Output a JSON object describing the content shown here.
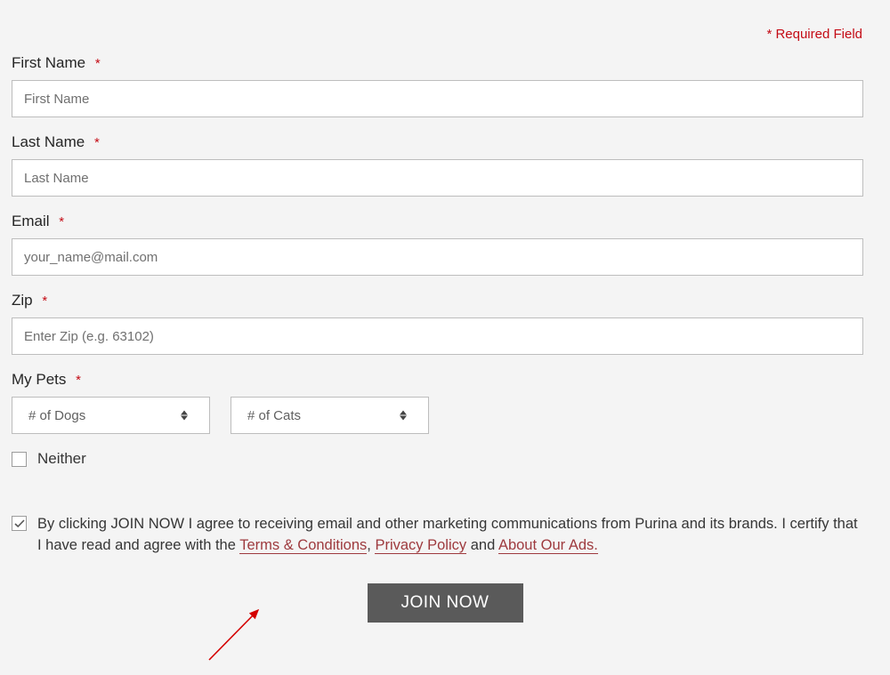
{
  "required_note": "* Required Field",
  "asterisk": "*",
  "fields": {
    "first_name": {
      "label": "First Name",
      "placeholder": "First Name"
    },
    "last_name": {
      "label": "Last Name",
      "placeholder": "Last Name"
    },
    "email": {
      "label": "Email",
      "placeholder": "your_name@mail.com"
    },
    "zip": {
      "label": "Zip",
      "placeholder": "Enter Zip (e.g. 63102)"
    }
  },
  "my_pets": {
    "label": "My Pets",
    "dogs_placeholder": "# of Dogs",
    "cats_placeholder": "# of Cats"
  },
  "neither": {
    "label": "Neither",
    "checked": false
  },
  "consent": {
    "checked": true,
    "text_before": "By clicking JOIN NOW I agree to receiving email and other marketing communications from Purina and its brands. I certify that I have read and agree with the ",
    "link1": "Terms & Conditions",
    "sep1": ", ",
    "link2": "Privacy Policy",
    "sep2": " and ",
    "link3": "About Our Ads."
  },
  "submit_label": "JOIN NOW"
}
